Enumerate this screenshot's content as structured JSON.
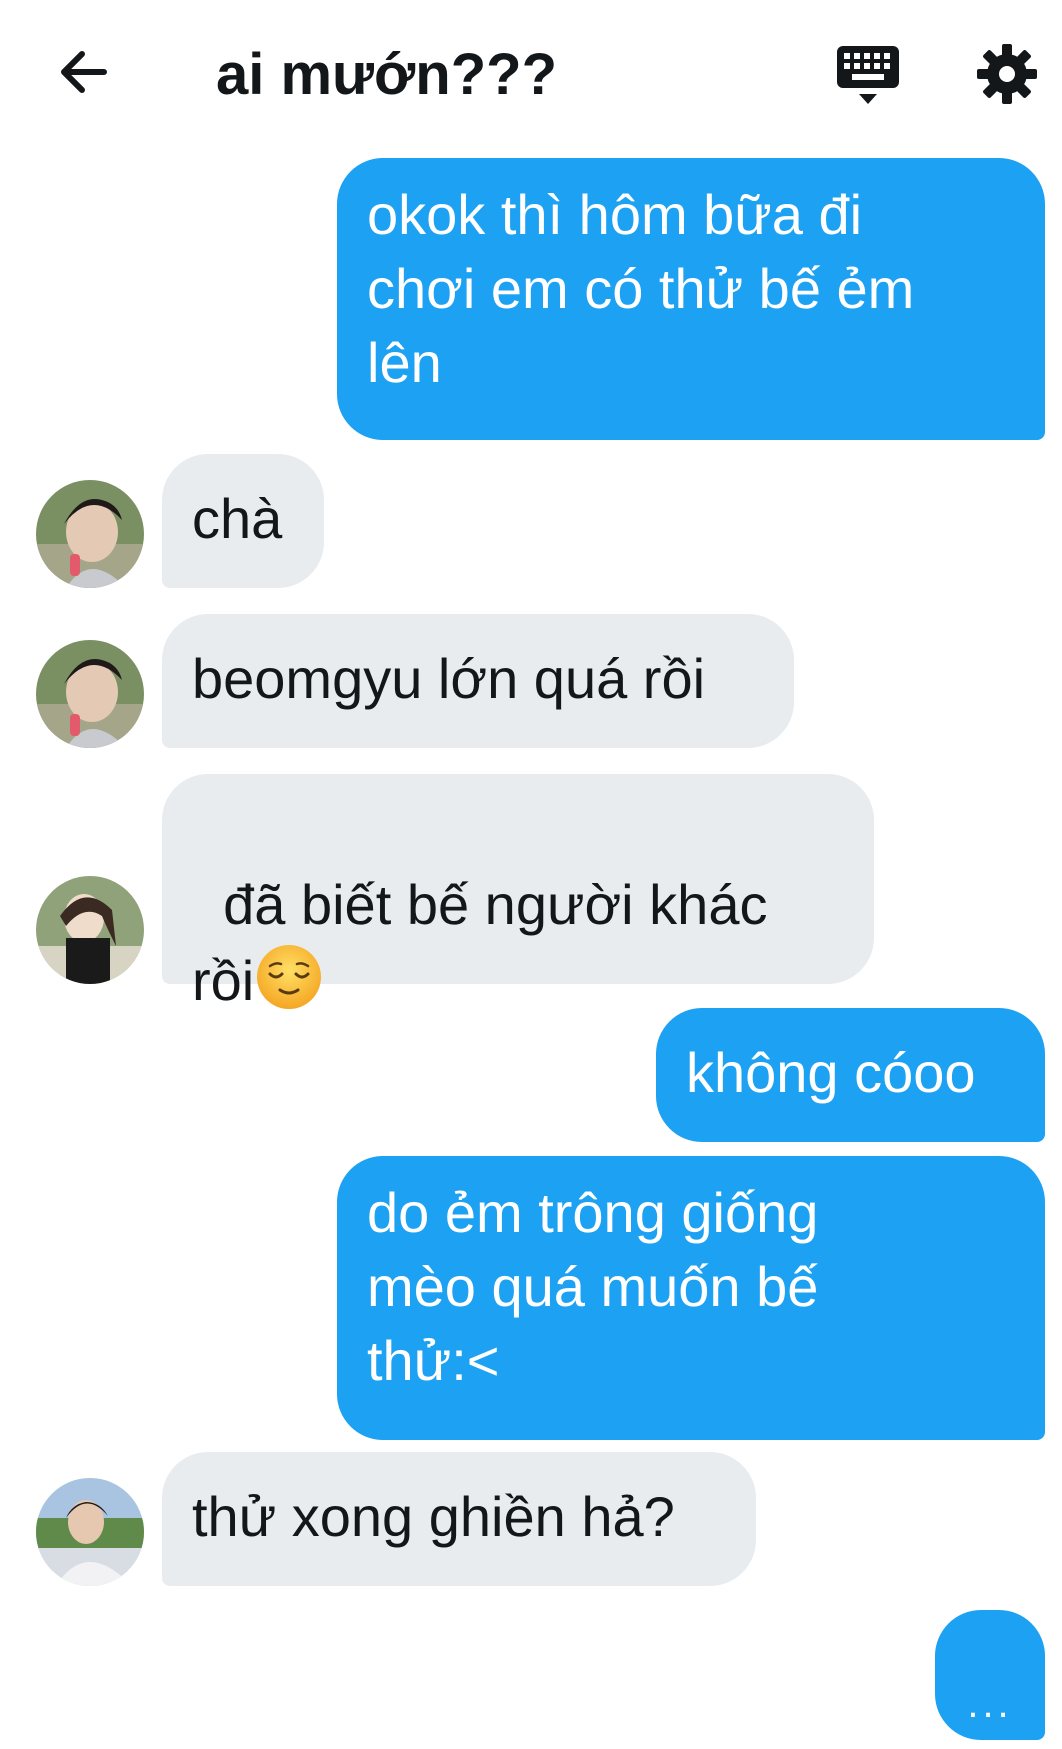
{
  "header": {
    "title": "ai mướn???",
    "icons": {
      "back": "arrow-left-icon",
      "keyboard": "keyboard-icon",
      "settings": "gear-icon"
    }
  },
  "messages": [
    {
      "side": "sent",
      "text": "okok thì hôm bữa đi\nchơi em có thử bế ẻm\nlên"
    },
    {
      "side": "received",
      "text": "chà"
    },
    {
      "side": "received",
      "text": "beomgyu lớn quá rồi"
    },
    {
      "side": "received",
      "text": "đã biết bế người khác\nrồi",
      "emoji": "relieved-face-emoji"
    },
    {
      "side": "sent",
      "text": "không cóoo"
    },
    {
      "side": "sent",
      "text": "do ẻm trông giống\nmèo quá muốn bế\nthử:<"
    },
    {
      "side": "received",
      "text": "thử xong ghiền hả?"
    }
  ],
  "typing_indicator": "...",
  "colors": {
    "sent_bubble": "#1da1f2",
    "received_bubble": "#e8ecef",
    "text_dark": "#14171a",
    "background": "#ffffff"
  }
}
